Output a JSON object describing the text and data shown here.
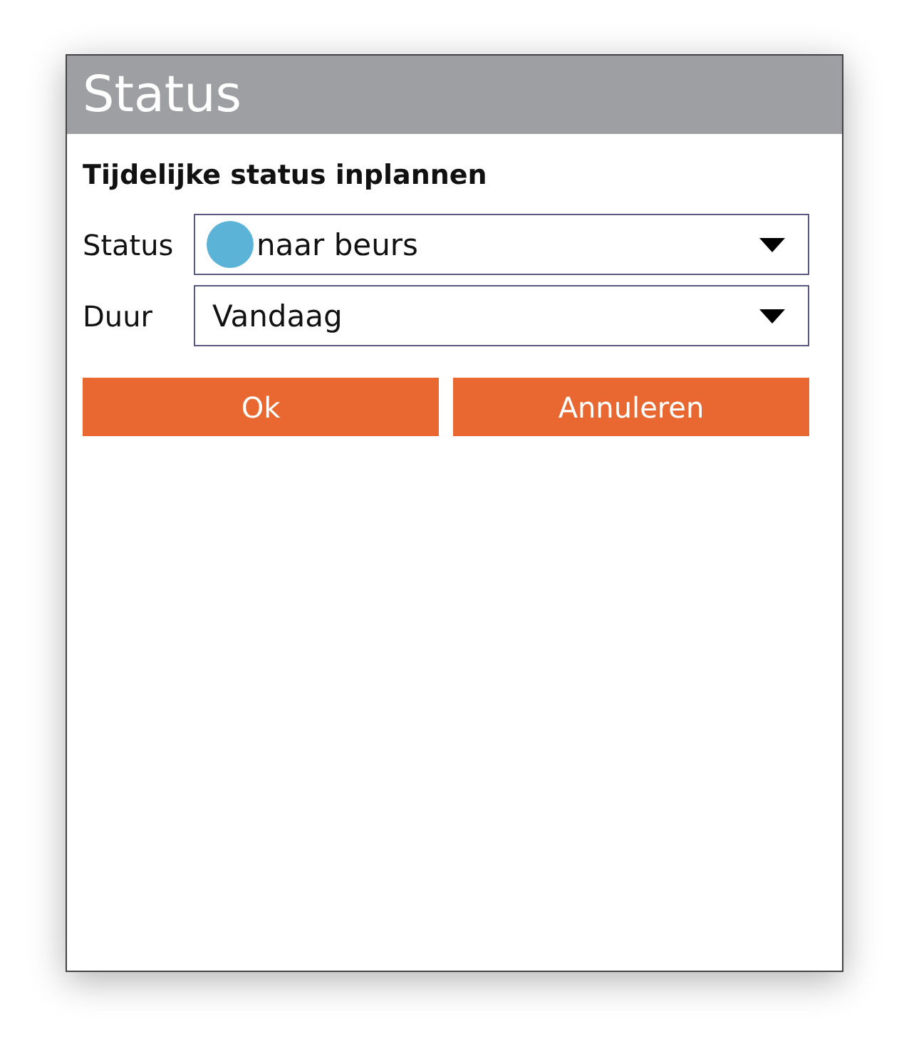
{
  "window": {
    "title": "Status"
  },
  "heading": "Tijdelijke status inplannen",
  "fields": [
    {
      "label": "Status",
      "value": "naar beurs",
      "color": "#5cb3d8"
    },
    {
      "label": "Duur",
      "value": "Vandaag"
    }
  ],
  "buttons": [
    "Ok",
    "Annuleren"
  ]
}
